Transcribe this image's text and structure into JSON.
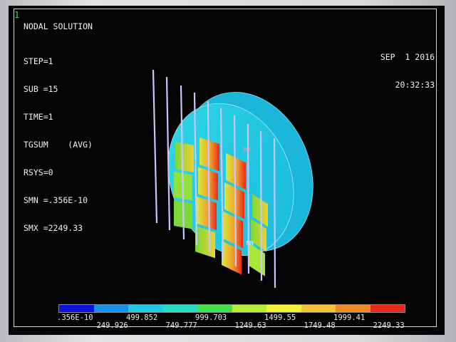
{
  "window": {
    "number": "1"
  },
  "header": {
    "title": "NODAL SOLUTION"
  },
  "stats": [
    "STEP=1",
    "SUB =15",
    "TIME=1",
    "TGSUM    (AVG)",
    "RSYS=0",
    "SMN =.356E-10",
    "SMX =2249.33"
  ],
  "date": {
    "day": "SEP  1 2016",
    "time": "20:32:33"
  },
  "markers": {
    "mx": "MX",
    "mn": "MN"
  },
  "legend": {
    "colors": [
      "#0b12d9",
      "#1a8fe8",
      "#22c8e6",
      "#28d9c4",
      "#44e04a",
      "#b8ec3a",
      "#f2f23a",
      "#f5c23a",
      "#f08a2a",
      "#e8281e"
    ],
    "labels_top": [
      ".356E-10",
      "499.852",
      "999.703",
      "1499.55",
      "1999.41"
    ],
    "labels_bottom": [
      "249.926",
      "749.777",
      "1249.63",
      "1749.48",
      "2249.33"
    ]
  }
}
